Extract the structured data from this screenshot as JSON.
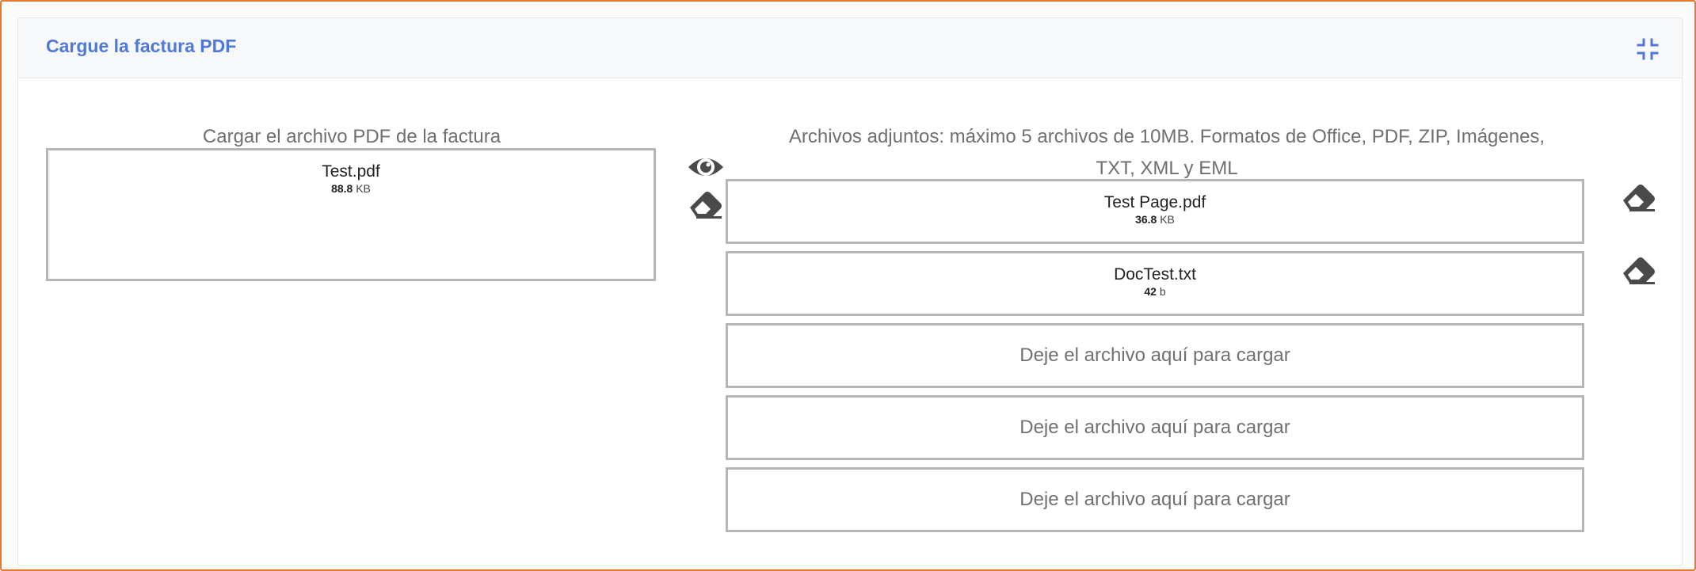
{
  "header": {
    "title": "Cargue la factura PDF",
    "collapse_icon": "compress-icon"
  },
  "invoice": {
    "caption": "Cargar el archivo PDF de la factura",
    "file": {
      "name": "Test.pdf",
      "size_value": "88.8",
      "size_unit": "KB"
    },
    "actions": [
      "eye-icon",
      "eraser-icon"
    ]
  },
  "attachments": {
    "caption_line1": "Archivos adjuntos: máximo 5 archivos de 10MB. Formatos de Office, PDF, ZIP, Imágenes,",
    "caption_line2": "TXT, XML y EML",
    "files": [
      {
        "name": "Test Page.pdf",
        "size_value": "36.8",
        "size_unit": "KB",
        "action_icon": "eraser-icon"
      },
      {
        "name": "DocTest.txt",
        "size_value": "42",
        "size_unit": "b",
        "action_icon": "eraser-icon"
      }
    ],
    "empty_slots": [
      "Deje el archivo aquí para cargar",
      "Deje el archivo aquí para cargar",
      "Deje el archivo aquí para cargar"
    ]
  },
  "colors": {
    "accent": "#4f78d8",
    "frame_border": "#e8792f",
    "dropzone_border": "#b6b6b6",
    "icon": "#4a4a4a"
  }
}
